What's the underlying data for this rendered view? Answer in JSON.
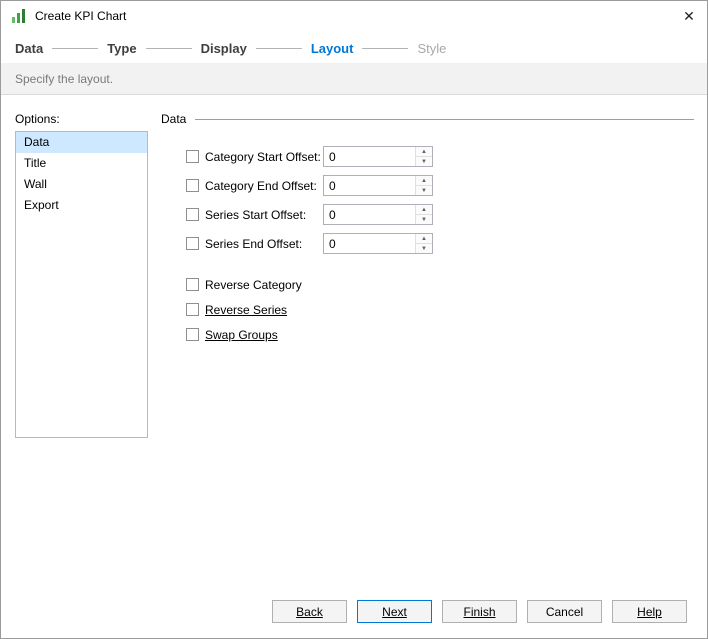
{
  "window": {
    "title": "Create KPI Chart",
    "close_glyph": "✕"
  },
  "steps": [
    {
      "label": "Data",
      "state": "done"
    },
    {
      "label": "Type",
      "state": "done"
    },
    {
      "label": "Display",
      "state": "done"
    },
    {
      "label": "Layout",
      "state": "active"
    },
    {
      "label": "Style",
      "state": "upcoming"
    }
  ],
  "subtitle": "Specify the layout.",
  "options_label": "Options:",
  "options": [
    {
      "label": "Data",
      "selected": true
    },
    {
      "label": "Title",
      "selected": false
    },
    {
      "label": "Wall",
      "selected": false
    },
    {
      "label": "Export",
      "selected": false
    }
  ],
  "section": {
    "title": "Data",
    "offset_rows": [
      {
        "label": "Category Start Offset:",
        "value": "0",
        "checked": false
      },
      {
        "label": "Category End Offset:",
        "value": "0",
        "checked": false
      },
      {
        "label": "Series Start Offset:",
        "value": "0",
        "checked": false
      },
      {
        "label": "Series End Offset:",
        "value": "0",
        "checked": false
      }
    ],
    "toggle_rows": [
      {
        "label": "Reverse Category",
        "checked": false
      },
      {
        "label": "Reverse Series",
        "checked": false
      },
      {
        "label": "Swap Groups",
        "checked": false
      }
    ]
  },
  "icons": {
    "spinner_up_glyph": "▲",
    "spinner_down_glyph": "▼"
  },
  "buttons": [
    {
      "label": "Back",
      "default": false
    },
    {
      "label": "Next",
      "default": true
    },
    {
      "label": "Finish",
      "default": false
    },
    {
      "label": "Cancel",
      "default": false
    },
    {
      "label": "Help",
      "default": false
    }
  ],
  "colors": {
    "accent": "#0078d7",
    "selection": "#cde8ff",
    "icon_green": "#43a047",
    "band_background": "#f2f2f2"
  }
}
